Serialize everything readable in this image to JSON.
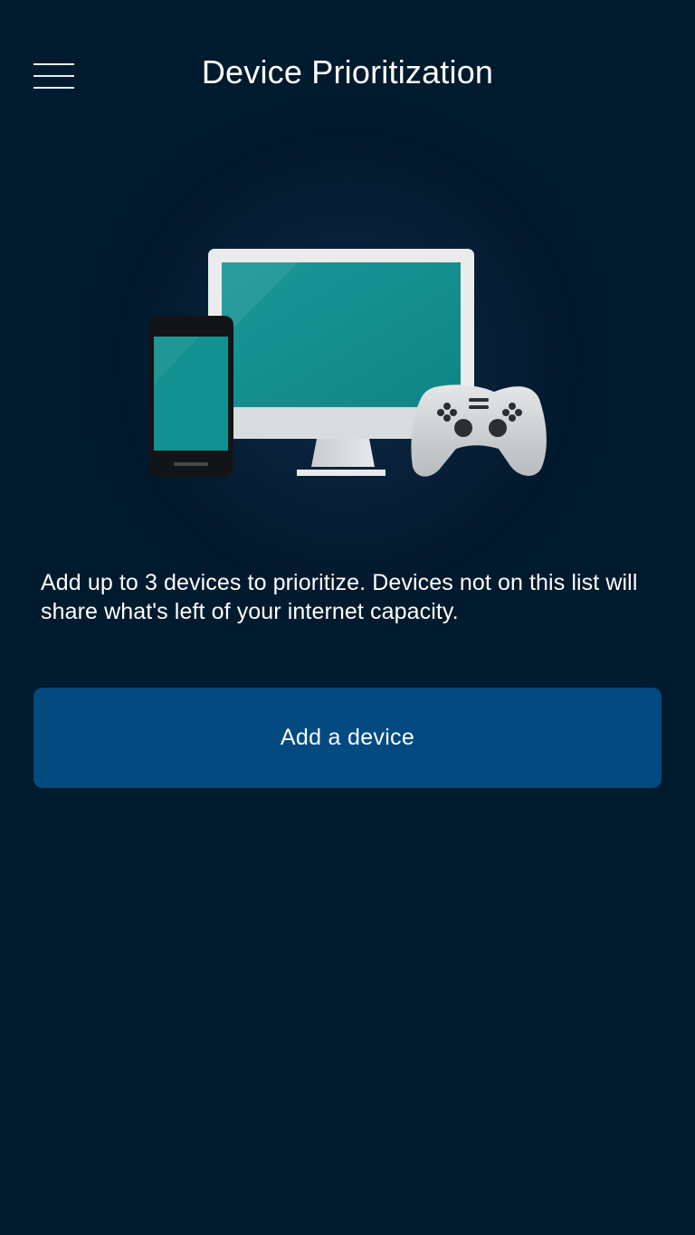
{
  "header": {
    "title": "Device Prioritization",
    "menu_icon": "hamburger-menu-icon"
  },
  "hero": {
    "icons": [
      "smartphone-icon",
      "monitor-icon",
      "game-controller-icon"
    ]
  },
  "main": {
    "description": "Add up to 3 devices to prioritize. Devices not on this list will share what's left of your internet capacity.",
    "add_button_label": "Add a device"
  },
  "colors": {
    "background": "#001a2e",
    "button": "#034a80",
    "screen_teal": "#138c8c"
  }
}
